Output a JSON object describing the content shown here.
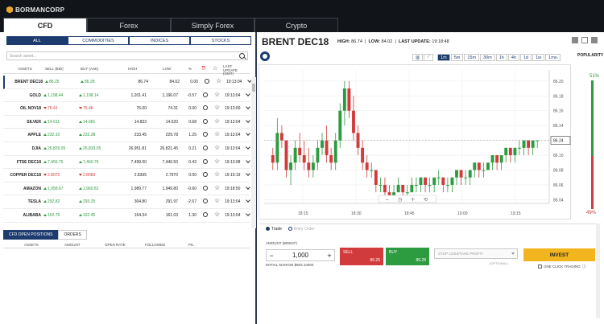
{
  "app": {
    "logo_text": "BORMANCORP",
    "tabs": [
      "CFD",
      "Forex",
      "Simply Forex",
      "Crypto"
    ],
    "active_tab": 0
  },
  "left": {
    "subtabs": [
      "ALL",
      "COMMODITIES",
      "INDICES",
      "STOCKS"
    ],
    "active_subtab": 0,
    "search_placeholder": "Search asset...",
    "headers": {
      "assets": "ASSETS",
      "sell": "SELL (BID)",
      "buy": "BUY (ASK)",
      "high": "HIGH",
      "low": "LOW",
      "pct": "%",
      "update": "LAST UPDATE (GMT)"
    },
    "rows": [
      {
        "name": "BRENT DEC18",
        "sell": "86.25",
        "sell_dir": "up",
        "buy": "86.28",
        "buy_dir": "up",
        "high": "86.74",
        "low": "84.02",
        "pct": "0.00",
        "time": "19:13:04"
      },
      {
        "name": "GOLD",
        "sell": "1,198.44",
        "sell_dir": "up",
        "buy": "1,198.14",
        "buy_dir": "up",
        "high": "1,201.41",
        "low": "1,196.07",
        "pct": "-0.57",
        "time": "19:13:04"
      },
      {
        "name": "OIL NOV18",
        "sell": "76.41",
        "sell_dir": "dn",
        "buy": "76.46",
        "buy_dir": "dn",
        "high": "76.00",
        "low": "74.31",
        "pct": "0.00",
        "time": "19:13:00"
      },
      {
        "name": "SILVER",
        "sell": "14.611",
        "sell_dir": "up",
        "buy": "14.681",
        "buy_dir": "up",
        "high": "14.833",
        "low": "14.620",
        "pct": "0.68",
        "time": "19:13:04"
      },
      {
        "name": "APPLE",
        "sell": "232.10",
        "sell_dir": "up",
        "buy": "232.38",
        "buy_dir": "up",
        "high": "233.45",
        "low": "229.78",
        "pct": "1.25",
        "time": "19:13:04"
      },
      {
        "name": "DJIA",
        "sell": "26,829.05",
        "sell_dir": "up",
        "buy": "26,833.05",
        "buy_dir": "up",
        "high": "26,951.81",
        "low": "26,821.45",
        "pct": "0.21",
        "time": "19:13:04"
      },
      {
        "name": "FTSE DEC18",
        "sell": "7,455.75",
        "sell_dir": "up",
        "buy": "7,460.75",
        "buy_dir": "up",
        "high": "7,499.00",
        "low": "7,440.50",
        "pct": "0.43",
        "time": "19:13:08"
      },
      {
        "name": "COPPER DEC18",
        "sell": "2.8072",
        "sell_dir": "dn",
        "buy": "2.8083",
        "buy_dir": "dn",
        "high": "2.8395",
        "low": "2.7970",
        "pct": "0.00",
        "time": "19:15:19"
      },
      {
        "name": "AMAZON",
        "sell": "1,958.67",
        "sell_dir": "up",
        "buy": "1,960.81",
        "buy_dir": "up",
        "high": "1,989.77",
        "low": "1,949.80",
        "pct": "-0.60",
        "time": "19:18:50"
      },
      {
        "name": "TESLA",
        "sell": "292.82",
        "sell_dir": "up",
        "buy": "293.25",
        "buy_dir": "up",
        "high": "304.80",
        "low": "291.97",
        "pct": "-2.67",
        "time": "19:13:04"
      },
      {
        "name": "ALIBABA",
        "sell": "162.76",
        "sell_dir": "up",
        "buy": "162.45",
        "buy_dir": "up",
        "high": "164.34",
        "low": "161.03",
        "pct": "1.30",
        "time": "19:13:04"
      }
    ],
    "position_tabs": [
      "CFD OPEN POSITIONS",
      "ORDERS"
    ],
    "position_headers": [
      "ASSETS",
      "AMOUNT",
      "OPEN RATE",
      "FOLLOWED",
      "P/L"
    ]
  },
  "right": {
    "instrument": "BRENT DEC18",
    "high_label": "HIGH:",
    "high_value": "86.74",
    "low_label": "LOW:",
    "low_value": "84.02",
    "update_label": "LAST UPDATE:",
    "update_value": "19:18:48",
    "timeframes": [
      "1m",
      "5m",
      "15m",
      "30m",
      "1h",
      "4h",
      "1d",
      "1w",
      "1mo"
    ],
    "active_tf": 0,
    "popularity_label": "POPULARITY",
    "popularity_buy": "51%",
    "popularity_sell": "49%",
    "trade_modes": [
      "Trade",
      "Entry Order"
    ],
    "amount_label": "AMOUNT (BRENT)",
    "amount_value": "1,000",
    "margin_note": "INITIAL MARGIN $803.10000",
    "sell_label": "SELL",
    "sell_price": "86.25",
    "buy_label": "BUY",
    "buy_price": "86.28",
    "sltp_placeholder": "STOP LOSS/TAKE PROFIT",
    "sltp_note": "(OPTIONAL)",
    "invest_label": "INVEST",
    "oneclick_label": "ONE CLICK TRADING"
  },
  "chart_data": {
    "type": "candlestick",
    "x_labels": [
      "18:15",
      "18:30",
      "18:45",
      "19:00",
      "19:15"
    ],
    "y_ticks": [
      "86.20",
      "86.18",
      "86.16",
      "86.14",
      "86.12",
      "86.10",
      "86.08",
      "86.06",
      "86.04"
    ],
    "y_range": [
      86.035,
      86.215
    ],
    "current_price_label": "86.24",
    "candles": [
      {
        "o": 86.1,
        "h": 86.11,
        "l": 86.08,
        "c": 86.09
      },
      {
        "o": 86.09,
        "h": 86.15,
        "l": 86.08,
        "c": 86.13
      },
      {
        "o": 86.13,
        "h": 86.14,
        "l": 86.11,
        "c": 86.12
      },
      {
        "o": 86.12,
        "h": 86.12,
        "l": 86.07,
        "c": 86.08
      },
      {
        "o": 86.08,
        "h": 86.1,
        "l": 86.06,
        "c": 86.09
      },
      {
        "o": 86.09,
        "h": 86.12,
        "l": 86.08,
        "c": 86.11
      },
      {
        "o": 86.11,
        "h": 86.13,
        "l": 86.09,
        "c": 86.1
      },
      {
        "o": 86.1,
        "h": 86.12,
        "l": 86.08,
        "c": 86.09
      },
      {
        "o": 86.09,
        "h": 86.11,
        "l": 86.07,
        "c": 86.08
      },
      {
        "o": 86.08,
        "h": 86.1,
        "l": 86.07,
        "c": 86.09
      },
      {
        "o": 86.09,
        "h": 86.12,
        "l": 86.08,
        "c": 86.11
      },
      {
        "o": 86.11,
        "h": 86.13,
        "l": 86.1,
        "c": 86.12
      },
      {
        "o": 86.12,
        "h": 86.14,
        "l": 86.09,
        "c": 86.1
      },
      {
        "o": 86.1,
        "h": 86.11,
        "l": 86.08,
        "c": 86.09
      },
      {
        "o": 86.09,
        "h": 86.13,
        "l": 86.08,
        "c": 86.12
      },
      {
        "o": 86.12,
        "h": 86.17,
        "l": 86.11,
        "c": 86.16
      },
      {
        "o": 86.16,
        "h": 86.2,
        "l": 86.14,
        "c": 86.19
      },
      {
        "o": 86.19,
        "h": 86.2,
        "l": 86.15,
        "c": 86.16
      },
      {
        "o": 86.16,
        "h": 86.18,
        "l": 86.12,
        "c": 86.13
      },
      {
        "o": 86.13,
        "h": 86.14,
        "l": 86.1,
        "c": 86.11
      },
      {
        "o": 86.11,
        "h": 86.12,
        "l": 86.08,
        "c": 86.09
      },
      {
        "o": 86.09,
        "h": 86.1,
        "l": 86.07,
        "c": 86.08
      },
      {
        "o": 86.08,
        "h": 86.09,
        "l": 86.07,
        "c": 86.08
      },
      {
        "o": 86.08,
        "h": 86.08,
        "l": 86.05,
        "c": 86.06
      },
      {
        "o": 86.06,
        "h": 86.07,
        "l": 86.05,
        "c": 86.06
      },
      {
        "o": 86.06,
        "h": 86.07,
        "l": 86.04,
        "c": 86.05
      },
      {
        "o": 86.05,
        "h": 86.06,
        "l": 86.04,
        "c": 86.04
      },
      {
        "o": 86.04,
        "h": 86.06,
        "l": 86.04,
        "c": 86.05
      },
      {
        "o": 86.05,
        "h": 86.07,
        "l": 86.05,
        "c": 86.06
      },
      {
        "o": 86.06,
        "h": 86.06,
        "l": 86.04,
        "c": 86.05
      },
      {
        "o": 86.05,
        "h": 86.06,
        "l": 86.04,
        "c": 86.05
      },
      {
        "o": 86.05,
        "h": 86.07,
        "l": 86.05,
        "c": 86.06
      },
      {
        "o": 86.06,
        "h": 86.07,
        "l": 86.05,
        "c": 86.06
      },
      {
        "o": 86.06,
        "h": 86.07,
        "l": 86.05,
        "c": 86.07
      },
      {
        "o": 86.07,
        "h": 86.07,
        "l": 86.05,
        "c": 86.06
      },
      {
        "o": 86.06,
        "h": 86.07,
        "l": 86.05,
        "c": 86.06
      },
      {
        "o": 86.06,
        "h": 86.07,
        "l": 86.05,
        "c": 86.07
      },
      {
        "o": 86.07,
        "h": 86.08,
        "l": 86.06,
        "c": 86.07
      },
      {
        "o": 86.07,
        "h": 86.07,
        "l": 86.05,
        "c": 86.06
      },
      {
        "o": 86.06,
        "h": 86.07,
        "l": 86.05,
        "c": 86.06
      },
      {
        "o": 86.06,
        "h": 86.07,
        "l": 86.05,
        "c": 86.07
      },
      {
        "o": 86.07,
        "h": 86.08,
        "l": 86.06,
        "c": 86.08
      },
      {
        "o": 86.08,
        "h": 86.08,
        "l": 86.06,
        "c": 86.07
      },
      {
        "o": 86.07,
        "h": 86.08,
        "l": 86.06,
        "c": 86.07
      },
      {
        "o": 86.07,
        "h": 86.08,
        "l": 86.06,
        "c": 86.08
      },
      {
        "o": 86.08,
        "h": 86.09,
        "l": 86.07,
        "c": 86.09
      },
      {
        "o": 86.09,
        "h": 86.09,
        "l": 86.07,
        "c": 86.08
      },
      {
        "o": 86.08,
        "h": 86.09,
        "l": 86.07,
        "c": 86.08
      },
      {
        "o": 86.08,
        "h": 86.09,
        "l": 86.08,
        "c": 86.09
      },
      {
        "o": 86.09,
        "h": 86.1,
        "l": 86.08,
        "c": 86.1
      },
      {
        "o": 86.1,
        "h": 86.1,
        "l": 86.08,
        "c": 86.09
      },
      {
        "o": 86.09,
        "h": 86.1,
        "l": 86.08,
        "c": 86.1
      },
      {
        "o": 86.1,
        "h": 86.11,
        "l": 86.09,
        "c": 86.11
      },
      {
        "o": 86.11,
        "h": 86.11,
        "l": 86.09,
        "c": 86.1
      },
      {
        "o": 86.1,
        "h": 86.11,
        "l": 86.09,
        "c": 86.11
      },
      {
        "o": 86.11,
        "h": 86.12,
        "l": 86.1,
        "c": 86.11
      },
      {
        "o": 86.11,
        "h": 86.12,
        "l": 86.1,
        "c": 86.12
      },
      {
        "o": 86.12,
        "h": 86.12,
        "l": 86.1,
        "c": 86.11
      },
      {
        "o": 86.11,
        "h": 86.12,
        "l": 86.1,
        "c": 86.12
      },
      {
        "o": 86.12,
        "h": 86.12,
        "l": 86.11,
        "c": 86.12
      }
    ],
    "colors": {
      "up": "#2d9b3f",
      "down": "#d23b3b"
    }
  }
}
